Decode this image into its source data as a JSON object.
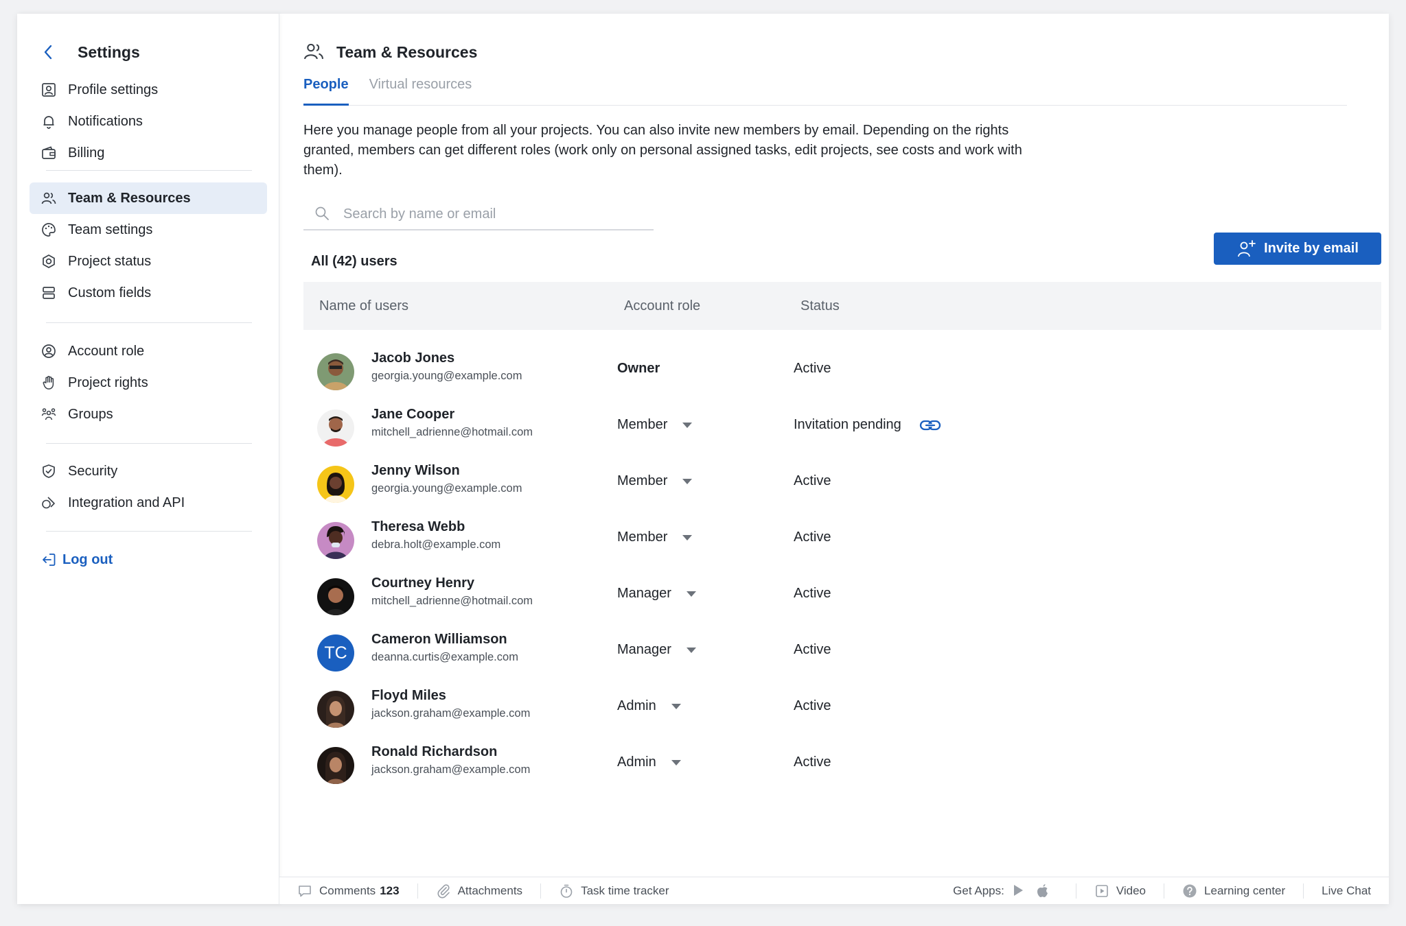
{
  "sidebar": {
    "title": "Settings",
    "group1": [
      {
        "label": "Profile settings",
        "icon": "profile-icon"
      },
      {
        "label": "Notifications",
        "icon": "bell-icon"
      },
      {
        "label": "Billing",
        "icon": "wallet-icon"
      }
    ],
    "group2": [
      {
        "label": "Team & Resources",
        "icon": "team-icon",
        "active": true
      },
      {
        "label": "Team settings",
        "icon": "palette-icon"
      },
      {
        "label": "Project status",
        "icon": "status-icon"
      },
      {
        "label": "Custom fields",
        "icon": "fields-icon"
      }
    ],
    "group3": [
      {
        "label": "Account role",
        "icon": "user-circle-icon"
      },
      {
        "label": "Project rights",
        "icon": "hand-icon"
      },
      {
        "label": "Groups",
        "icon": "groups-icon"
      }
    ],
    "group4": [
      {
        "label": "Security",
        "icon": "shield-icon"
      },
      {
        "label": "Integration and API",
        "icon": "integration-icon"
      }
    ],
    "logout": "Log out"
  },
  "header": {
    "title": "Team & Resources"
  },
  "tabs": [
    {
      "label": "People",
      "active": true
    },
    {
      "label": "Virtual resources",
      "active": false
    }
  ],
  "intro": "Here you manage people from all your projects. You can also invite new members by email. Depending on the rights granted, members can get different roles (work only on personal assigned tasks, edit projects, see costs and work with them).",
  "search": {
    "placeholder": "Search by name or email",
    "value": ""
  },
  "count_label": "All (42) users",
  "invite_label": "Invite by email",
  "table": {
    "columns": [
      "Name of users",
      "Account role",
      "Status"
    ],
    "rows": [
      {
        "name": "Jacob Jones",
        "email": "georgia.young@example.com",
        "role": "Owner",
        "dropdown": false,
        "status": "Active"
      },
      {
        "name": "Jane Cooper",
        "email": "mitchell_adrienne@hotmail.com",
        "role": "Member",
        "dropdown": true,
        "status": "Invitation pending",
        "link": true
      },
      {
        "name": "Jenny Wilson",
        "email": "georgia.young@example.com",
        "role": "Member",
        "dropdown": true,
        "status": "Active"
      },
      {
        "name": "Theresa Webb",
        "email": "debra.holt@example.com",
        "role": "Member",
        "dropdown": true,
        "status": "Active"
      },
      {
        "name": "Courtney Henry",
        "email": "mitchell_adrienne@hotmail.com",
        "role": "Manager",
        "dropdown": true,
        "status": "Active"
      },
      {
        "name": "Cameron Williamson",
        "email": "deanna.curtis@example.com",
        "role": "Manager",
        "dropdown": true,
        "status": "Active",
        "initials": "TC"
      },
      {
        "name": "Floyd Miles",
        "email": "jackson.graham@example.com",
        "role": "Admin",
        "dropdown": true,
        "status": "Active"
      },
      {
        "name": "Ronald Richardson",
        "email": "jackson.graham@example.com",
        "role": "Admin",
        "dropdown": true,
        "status": "Active"
      }
    ]
  },
  "footer": {
    "comments_label": "Comments",
    "comments_count": "123",
    "attachments": "Attachments",
    "time_tracker": "Task time tracker",
    "get_apps": "Get Apps:",
    "video": "Video",
    "learning": "Learning center",
    "live_chat": "Live Chat"
  },
  "colors": {
    "accent": "#1a5fbf",
    "active_bg": "#e6edf7",
    "table_header_bg": "#f3f4f6"
  }
}
